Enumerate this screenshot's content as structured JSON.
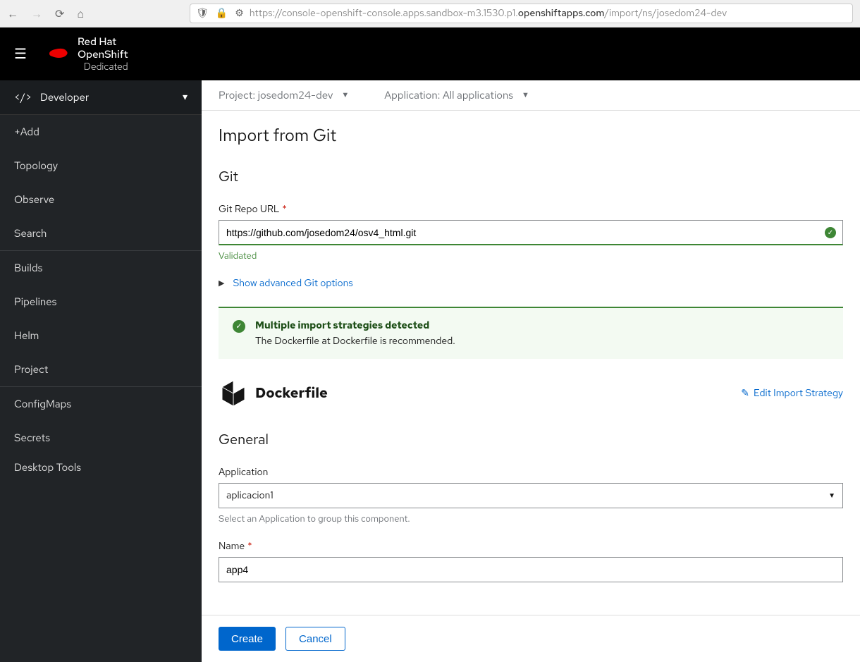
{
  "browser": {
    "url_prefix": "https://console-openshift-console.apps.sandbox-m3.1530.p1.",
    "url_domain": "openshiftapps.com",
    "url_path": "/import/ns/josedom24-dev"
  },
  "brand": {
    "line1": "Red Hat",
    "line2": "OpenShift",
    "line3": "Dedicated"
  },
  "perspective": {
    "label": "Developer"
  },
  "sidebar": {
    "items": [
      "+Add",
      "Topology",
      "Observe",
      "Search",
      "Builds",
      "Pipelines",
      "Helm",
      "Project",
      "ConfigMaps",
      "Secrets",
      "Desktop Tools"
    ]
  },
  "topbar": {
    "project_label": "Project: josedom24-dev",
    "application_label": "Application: All applications"
  },
  "page": {
    "title": "Import from Git"
  },
  "git": {
    "section_title": "Git",
    "url_label": "Git Repo URL",
    "url_value": "https://github.com/josedom24/osv4_html.git",
    "validated": "Validated",
    "advanced": "Show advanced Git options"
  },
  "alert": {
    "title": "Multiple import strategies detected",
    "desc": "The Dockerfile at Dockerfile is recommended."
  },
  "strategy": {
    "name": "Dockerfile",
    "edit": "Edit Import Strategy"
  },
  "general": {
    "section_title": "General",
    "application_label": "Application",
    "application_value": "aplicacion1",
    "application_help": "Select an Application to group this component.",
    "name_label": "Name",
    "name_value": "app4"
  },
  "footer": {
    "create": "Create",
    "cancel": "Cancel"
  }
}
